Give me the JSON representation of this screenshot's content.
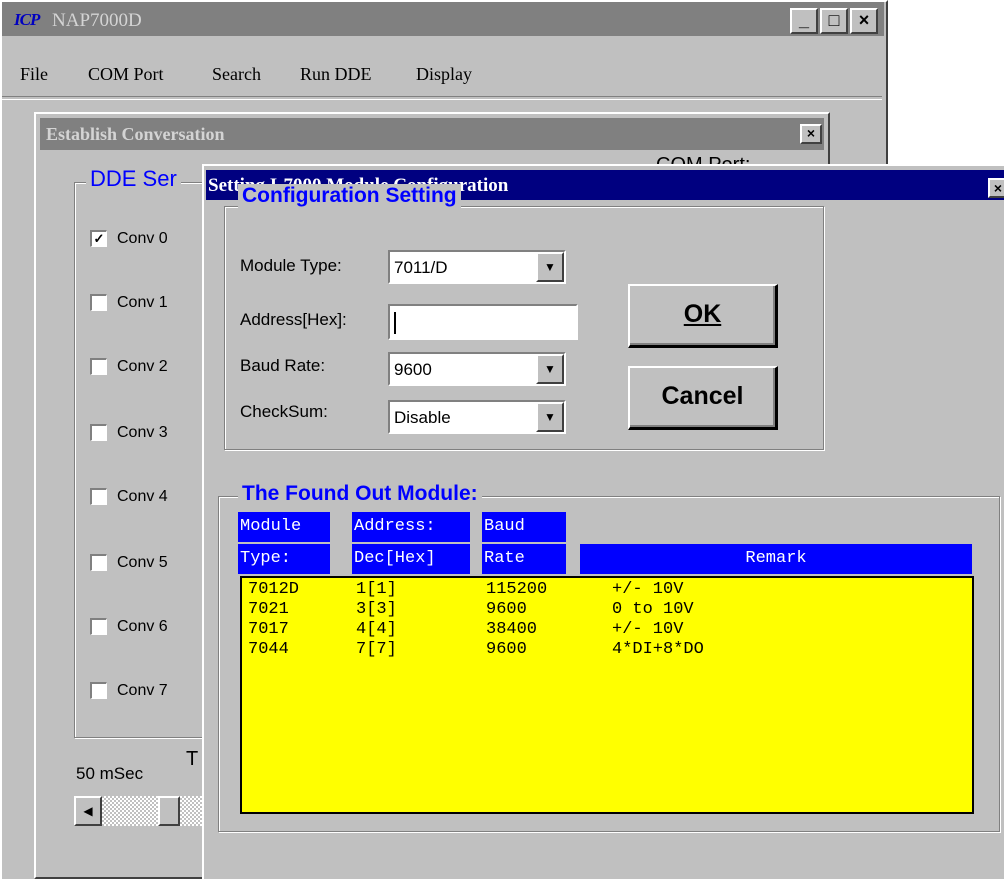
{
  "main_window": {
    "logo": "ICP",
    "title": "NAP7000D",
    "minimize": "_",
    "maximize": "□",
    "close": "×"
  },
  "menu": [
    "File",
    "COM Port",
    "Search",
    "Run DDE",
    "Display"
  ],
  "conversation": {
    "title": "Establish Conversation",
    "close": "×",
    "com_port_label": "COM Port:",
    "group_label": "DDE Ser",
    "conversations": [
      {
        "label": "Conv 0",
        "checked": true
      },
      {
        "label": "Conv 1",
        "checked": false
      },
      {
        "label": "Conv 2",
        "checked": false
      },
      {
        "label": "Conv 3",
        "checked": false
      },
      {
        "label": "Conv 4",
        "checked": false
      },
      {
        "label": "Conv 5",
        "checked": false
      },
      {
        "label": "Conv 6",
        "checked": false
      },
      {
        "label": "Conv 7",
        "checked": false
      }
    ],
    "interval_label": "50 mSec",
    "t_label": "T"
  },
  "setting": {
    "title": "Setting I-7000 Module Configuration",
    "close": "×",
    "config_group_label": "Configuration Setting",
    "module_type_label": "Module Type:",
    "module_type_value": "7011/D",
    "address_label": "Address[Hex]:",
    "address_value": "",
    "baud_rate_label": "Baud Rate:",
    "baud_rate_value": "9600",
    "checksum_label": "CheckSum:",
    "checksum_value": "Disable",
    "ok_label": "OK",
    "cancel_label": "Cancel",
    "found_group_label": "The Found Out Module:",
    "headers": {
      "module_1": "Module",
      "module_2": "Type:",
      "address_1": "Address:",
      "address_2": "Dec[Hex]",
      "baud_1": "Baud",
      "baud_2": "Rate",
      "remark": "Remark"
    },
    "modules": [
      {
        "type": "7012D",
        "address": "1[1]",
        "baud": "115200",
        "remark": "+/- 10V"
      },
      {
        "type": "7021",
        "address": "3[3]",
        "baud": "9600",
        "remark": "0 to 10V"
      },
      {
        "type": "7017",
        "address": "4[4]",
        "baud": "38400",
        "remark": "+/- 10V"
      },
      {
        "type": "7044",
        "address": "7[7]",
        "baud": "9600",
        "remark": "4*DI+8*DO"
      }
    ]
  }
}
